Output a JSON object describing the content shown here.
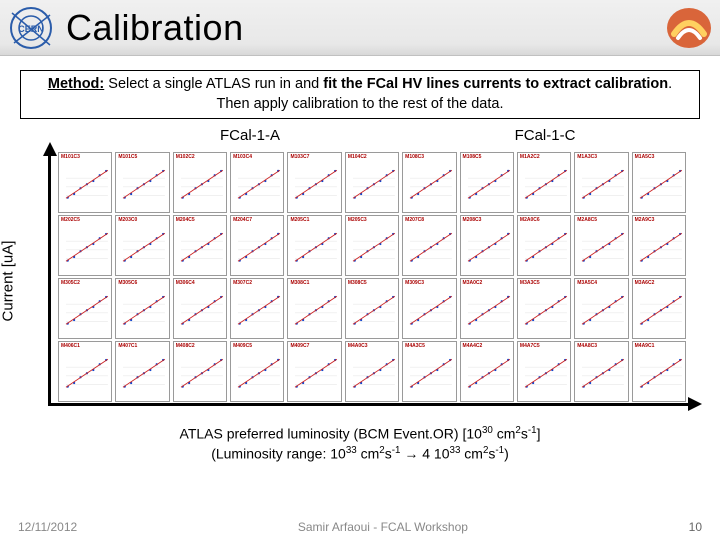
{
  "header": {
    "title": "Calibration"
  },
  "method": {
    "label": "Method:",
    "t1": " Select a single ATLAS run in and ",
    "b1": "fit the FCal HV lines currents to extract calibration",
    "t2": ". Then apply calibration to the rest of the data."
  },
  "sections": {
    "a": "FCal-1-A",
    "c": "FCal-1-C"
  },
  "axes": {
    "y": "Current [uA]"
  },
  "xcaption": {
    "l1a": "ATLAS preferred luminosity (BCM Event.OR)  [10",
    "l1sup": "30",
    "l1b": " cm",
    "l1sup2": "2",
    "l1c": "s",
    "l1sup3": "-1",
    "l1d": "]",
    "l2a": "(Luminosity range: 10",
    "l2sup": "33",
    "l2b": " cm",
    "l2sup2": "2",
    "l2c": "s",
    "l2sup3": "-1",
    "l2arrow": " → ",
    "l2d": "4 10",
    "l2sup4": "33",
    "l2e": " cm",
    "l2sup5": "2",
    "l2f": "s",
    "l2sup6": "-1",
    "l2g": ")"
  },
  "footer": {
    "date": "12/11/2012",
    "center": "Samir Arfaoui - FCAL Workshop",
    "page": "10"
  },
  "chart_data": {
    "type": "scatter",
    "layout": {
      "rows": 4,
      "cols": 11
    },
    "xlabel": "ATLAS preferred luminosity (BCM Event.OR) [1e30 cm^2 s^-1]",
    "ylabel": "Current [uA]",
    "x_range_note": "Luminosity range 1e33 to 4e33 cm^-2 s^-1",
    "panels": [
      {
        "row": 0,
        "col": 0,
        "label": "M101C3",
        "trend": "linear",
        "slope": 1
      },
      {
        "row": 0,
        "col": 1,
        "label": "M101C5",
        "trend": "linear",
        "slope": 1
      },
      {
        "row": 0,
        "col": 2,
        "label": "M102C2",
        "trend": "linear",
        "slope": 1
      },
      {
        "row": 0,
        "col": 3,
        "label": "M103C4",
        "trend": "linear",
        "slope": 1
      },
      {
        "row": 0,
        "col": 4,
        "label": "M103C7",
        "trend": "linear",
        "slope": 1
      },
      {
        "row": 0,
        "col": 5,
        "label": "M104C2",
        "trend": "linear",
        "slope": 1
      },
      {
        "row": 0,
        "col": 6,
        "label": "M108C3",
        "trend": "linear",
        "slope": 1
      },
      {
        "row": 0,
        "col": 7,
        "label": "M108C5",
        "trend": "linear",
        "slope": 1
      },
      {
        "row": 0,
        "col": 8,
        "label": "M1A2C2",
        "trend": "linear",
        "slope": 1
      },
      {
        "row": 0,
        "col": 9,
        "label": "M1A3C3",
        "trend": "linear",
        "slope": 1
      },
      {
        "row": 0,
        "col": 10,
        "label": "M1A5C3",
        "trend": "linear",
        "slope": 1
      },
      {
        "row": 1,
        "col": 0,
        "label": "M202C5",
        "trend": "linear",
        "slope": 1
      },
      {
        "row": 1,
        "col": 1,
        "label": "M203C0",
        "trend": "linear",
        "slope": 1
      },
      {
        "row": 1,
        "col": 2,
        "label": "M204C5",
        "trend": "linear",
        "slope": 1
      },
      {
        "row": 1,
        "col": 3,
        "label": "M204C7",
        "trend": "linear",
        "slope": 1
      },
      {
        "row": 1,
        "col": 4,
        "label": "M205C1",
        "trend": "linear",
        "slope": 1
      },
      {
        "row": 1,
        "col": 5,
        "label": "M205C3",
        "trend": "linear",
        "slope": 1
      },
      {
        "row": 1,
        "col": 6,
        "label": "M207C8",
        "trend": "linear",
        "slope": 1
      },
      {
        "row": 1,
        "col": 7,
        "label": "M208C3",
        "trend": "linear",
        "slope": 1
      },
      {
        "row": 1,
        "col": 8,
        "label": "M2A0C6",
        "trend": "linear",
        "slope": 1
      },
      {
        "row": 1,
        "col": 9,
        "label": "M2A8C5",
        "trend": "linear",
        "slope": 1
      },
      {
        "row": 1,
        "col": 10,
        "label": "M2A9C3",
        "trend": "linear",
        "slope": 1
      },
      {
        "row": 2,
        "col": 0,
        "label": "M305C2",
        "trend": "linear",
        "slope": 1
      },
      {
        "row": 2,
        "col": 1,
        "label": "M305C6",
        "trend": "linear",
        "slope": 1
      },
      {
        "row": 2,
        "col": 2,
        "label": "M306C4",
        "trend": "linear",
        "slope": 1
      },
      {
        "row": 2,
        "col": 3,
        "label": "M307C2",
        "trend": "linear",
        "slope": 1
      },
      {
        "row": 2,
        "col": 4,
        "label": "M308C1",
        "trend": "linear",
        "slope": 1
      },
      {
        "row": 2,
        "col": 5,
        "label": "M308C5",
        "trend": "linear",
        "slope": 1
      },
      {
        "row": 2,
        "col": 6,
        "label": "M309C3",
        "trend": "linear",
        "slope": 1
      },
      {
        "row": 2,
        "col": 7,
        "label": "M3A0C2",
        "trend": "linear",
        "slope": 1
      },
      {
        "row": 2,
        "col": 8,
        "label": "M3A3C5",
        "trend": "linear",
        "slope": 1
      },
      {
        "row": 2,
        "col": 9,
        "label": "M3A5C4",
        "trend": "linear",
        "slope": 1
      },
      {
        "row": 2,
        "col": 10,
        "label": "M3A6C2",
        "trend": "linear",
        "slope": 1
      },
      {
        "row": 3,
        "col": 0,
        "label": "M406C1",
        "trend": "linear",
        "slope": 1
      },
      {
        "row": 3,
        "col": 1,
        "label": "M407C1",
        "trend": "linear",
        "slope": 1
      },
      {
        "row": 3,
        "col": 2,
        "label": "M408C2",
        "trend": "linear",
        "slope": 1
      },
      {
        "row": 3,
        "col": 3,
        "label": "M409C5",
        "trend": "linear",
        "slope": 1
      },
      {
        "row": 3,
        "col": 4,
        "label": "M409C7",
        "trend": "linear",
        "slope": 1
      },
      {
        "row": 3,
        "col": 5,
        "label": "M4A0C3",
        "trend": "linear",
        "slope": 1
      },
      {
        "row": 3,
        "col": 6,
        "label": "M4A3C5",
        "trend": "linear",
        "slope": 1
      },
      {
        "row": 3,
        "col": 7,
        "label": "M4A4C2",
        "trend": "linear",
        "slope": 1
      },
      {
        "row": 3,
        "col": 8,
        "label": "M4A7C5",
        "trend": "linear",
        "slope": 1
      },
      {
        "row": 3,
        "col": 9,
        "label": "M4A8C3",
        "trend": "linear",
        "slope": 1
      },
      {
        "row": 3,
        "col": 10,
        "label": "M4A9C1",
        "trend": "linear",
        "slope": 1
      }
    ]
  }
}
